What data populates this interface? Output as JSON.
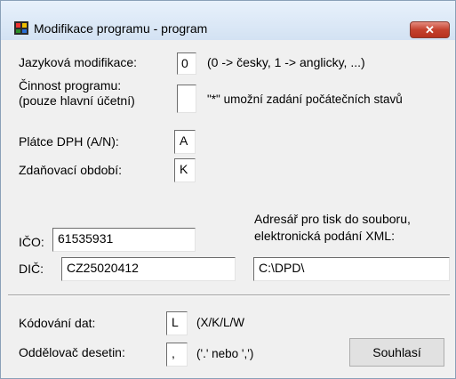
{
  "window": {
    "title": "Modifikace programu - program",
    "close_glyph": "✕",
    "icon": "app-icon"
  },
  "fields": {
    "language": {
      "label": "Jazyková modifikace:",
      "value": "0",
      "hint": "(0 -> česky, 1 -> anglicky, ...)"
    },
    "activity": {
      "label_line1": "Činnost programu:",
      "label_line2": "(pouze hlavní účetní)",
      "value": "",
      "hint": "\"*\" umožní zadání počátečních stavů"
    },
    "vat_payer": {
      "label": "Plátce DPH (A/N):",
      "value": "A"
    },
    "tax_period": {
      "label": "Zdaňovací období:",
      "value": "K"
    },
    "ico": {
      "label": "IČO:",
      "value": "61535931"
    },
    "dic": {
      "label": "DIČ:",
      "value": "CZ25020412"
    },
    "print_dir": {
      "label_line1": "Adresář pro tisk do souboru,",
      "label_line2": "elektronická podání XML:",
      "value": "C:\\DPD\\"
    },
    "encoding": {
      "label": "Kódování dat:",
      "value": "L",
      "hint": "(X/K/L/W"
    },
    "decimal_sep": {
      "label": "Oddělovač desetin:",
      "value": ",",
      "hint": "('.' nebo ',')"
    }
  },
  "buttons": {
    "agree": "Souhlasí"
  }
}
